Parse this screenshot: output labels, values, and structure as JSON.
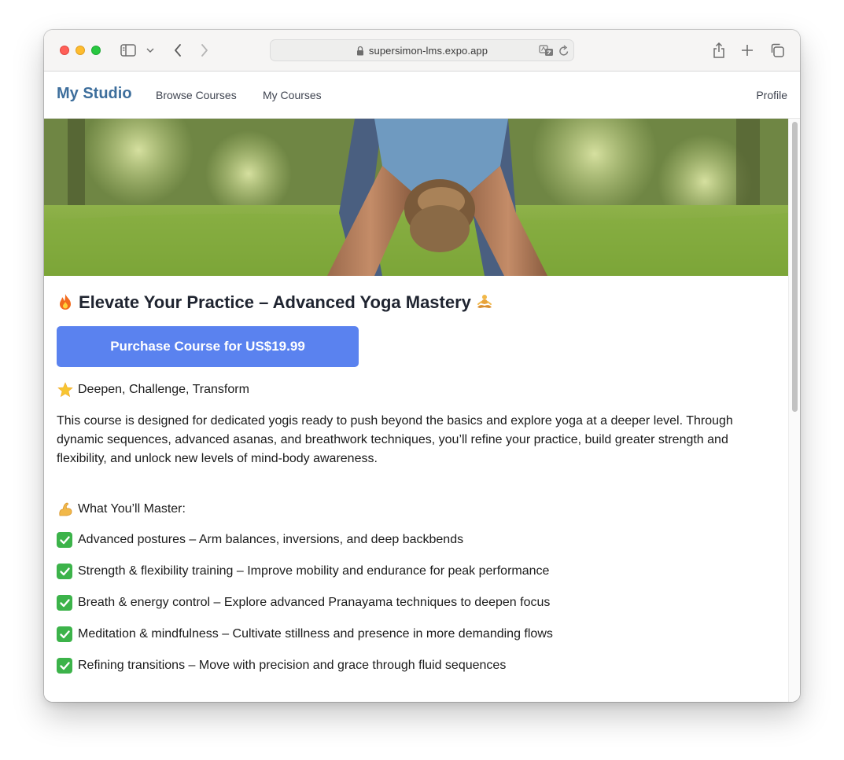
{
  "browser": {
    "url": "supersimon-lms.expo.app"
  },
  "app": {
    "brand": "My Studio",
    "nav": {
      "browse": "Browse Courses",
      "my_courses": "My Courses",
      "profile": "Profile"
    }
  },
  "course": {
    "title": "Elevate Your Practice – Advanced Yoga Mastery",
    "purchase_label": "Purchase Course for US$19.99",
    "tagline": "Deepen, Challenge, Transform",
    "description": "This course is designed for dedicated yogis ready to push beyond the basics and explore yoga at a deeper level. Through dynamic sequences, advanced asanas, and breathwork techniques, you’ll refine your practice, build greater strength and flexibility, and unlock new levels of mind-body awareness.",
    "master_heading": "What You’ll Master:",
    "features": [
      "Advanced postures – Arm balances, inversions, and deep backbends",
      "Strength & flexibility training – Improve mobility and endurance for peak performance",
      "Breath & energy control – Explore advanced Pranayama techniques to deepen focus",
      "Meditation & mindfulness – Cultivate stillness and presence in more demanding flows",
      "Refining transitions – Move with precision and grace through fluid sequences"
    ]
  },
  "colors": {
    "brand": "#3d6e9c",
    "button": "#5a82ef",
    "check": "#3cb34a"
  },
  "icons": {
    "title_left": "fire-icon",
    "title_right": "person-meditating-icon",
    "tagline": "glowing-star-icon",
    "master": "flexed-biceps-icon",
    "feature": "check-mark-button-icon"
  }
}
